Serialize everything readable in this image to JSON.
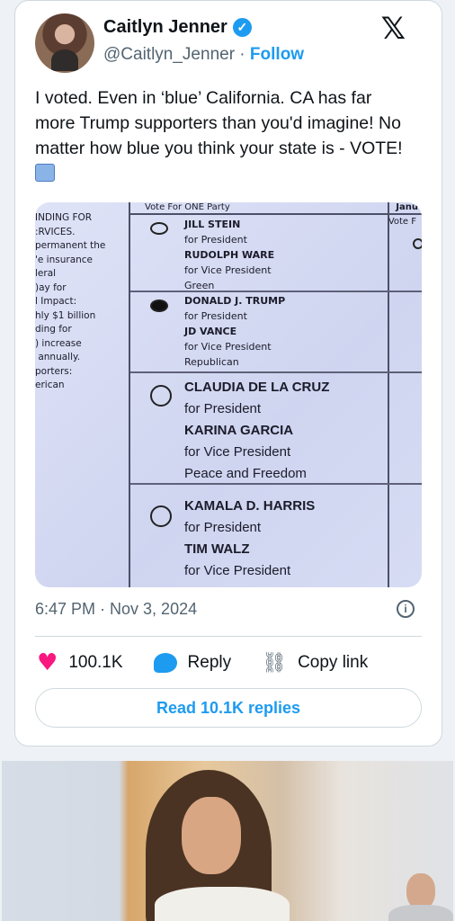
{
  "tweet": {
    "author_name": "Caitlyn Jenner",
    "handle": "@Caitlyn_Jenner",
    "separator": " · ",
    "follow_label": "Follow",
    "text": "I voted. Even in ‘blue’ California. CA has far more Trump supporters than you'd imagine! No matter how blue you think your state is - VOTE!",
    "timestamp": "6:47 PM · Nov 3, 2024",
    "likes": "100.1K",
    "reply_label": "Reply",
    "copy_link_label": "Copy link",
    "read_replies_label": "Read 10.1K replies"
  },
  "ballot": {
    "column_header": "Vote For ONE Party",
    "right_header": "Janu",
    "right_subheader": "Vote F",
    "left_text": "INDING FOR\n:RVICES.\npermanent the\n'e insurance\nleral\n)ay for\nl Impact:\nhly $1 billion\nding for\n) increase\n annually.\nporters:\nerican",
    "candidates": [
      {
        "president": "JILL STEIN",
        "for_president": "for President",
        "vp": "RUDOLPH WARE",
        "for_vp": "for Vice President",
        "party": "Green",
        "selected": false
      },
      {
        "president": "DONALD J. TRUMP",
        "for_president": "for President",
        "vp": "JD VANCE",
        "for_vp": "for Vice President",
        "party": "Republican",
        "selected": true
      },
      {
        "president": "CLAUDIA DE LA CRUZ",
        "for_president": "for President",
        "vp": "KARINA GARCIA",
        "for_vp": "for Vice President",
        "party": "Peace and Freedom",
        "selected": false
      },
      {
        "president": "KAMALA D. HARRIS",
        "for_president": "for President",
        "vp": "TIM WALZ",
        "for_vp": "for Vice President",
        "party": "",
        "selected": false
      }
    ]
  },
  "icons": {
    "verified": "verified-badge-icon",
    "close": "x-logo-icon",
    "info": "info-icon",
    "heart": "heart-icon",
    "reply": "reply-bubble-icon",
    "link": "link-icon",
    "ballot_box": "ballot-box-emoji-icon"
  },
  "colors": {
    "accent": "#1d9bf0",
    "like": "#f91880",
    "text": "#0f1419",
    "muted": "#536471"
  }
}
